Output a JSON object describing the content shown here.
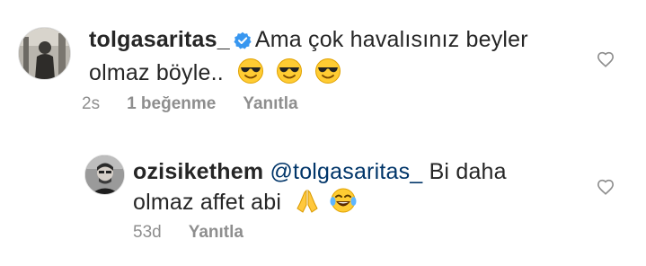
{
  "comments": [
    {
      "username": "tolgasaritas_",
      "verified": true,
      "text_line1": "Ama çok havalısınız beyler",
      "text_line2": "olmaz böyle..",
      "emojis": [
        "sunglasses-emoji",
        "sunglasses-emoji",
        "sunglasses-emoji"
      ],
      "time": "2s",
      "likes": "1 beğenme",
      "reply_label": "Yanıtla"
    },
    {
      "username": "ozisikethem",
      "mention": "@tolgasaritas_",
      "text_line1_rest": "Bi daha",
      "text_line2": "olmaz affet abi",
      "emojis": [
        "folded-hands-emoji",
        "tears-of-joy-emoji"
      ],
      "time": "53d",
      "reply_label": "Yanıtla"
    }
  ],
  "icons": {
    "like": "heart-outline-icon",
    "verified": "verified-badge-icon"
  },
  "colors": {
    "text": "#262626",
    "meta": "#8e8e8e",
    "mention": "#003569",
    "verified": "#3897f0"
  }
}
